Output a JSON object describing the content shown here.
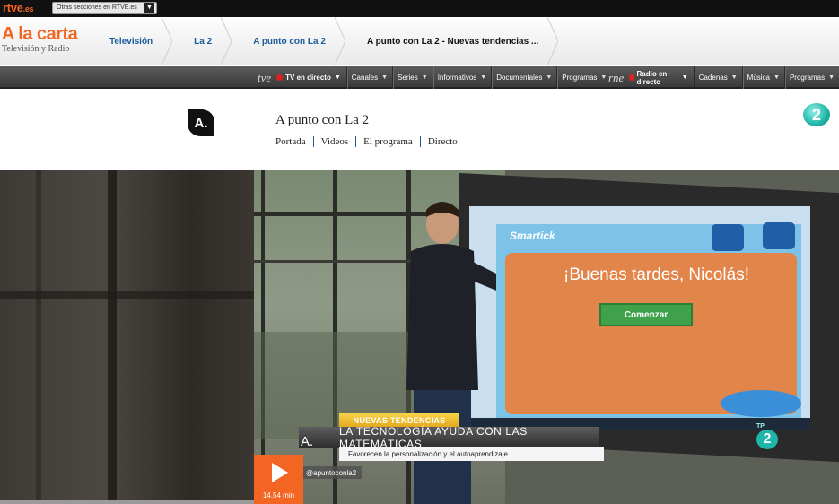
{
  "topbar": {
    "logo": "rtve",
    "logo_suffix": ".es",
    "sections_select": "Otras secciones en RTVE.es"
  },
  "header": {
    "brand_title": "A la carta",
    "brand_subtitle": "Televisión y Radio",
    "breadcrumbs": [
      "Televisión",
      "La 2",
      "A punto con La 2",
      "A punto con La 2 - Nuevas tendencias ..."
    ]
  },
  "navbar": {
    "tv_logo": "tve",
    "tv_live": "TV en directo",
    "tv_items": [
      "Canales",
      "Series",
      "Informativos",
      "Documentales",
      "Programas"
    ],
    "radio_logo": "rne",
    "radio_live": "Radio en directo",
    "radio_items": [
      "Cadenas",
      "Música",
      "Programas"
    ],
    "accent_live": "#e02020"
  },
  "program": {
    "logo_text": "A.",
    "title": "A punto con La 2",
    "nav": [
      "Portada",
      "Videos",
      "El programa",
      "Directo"
    ],
    "channel_badge": "2"
  },
  "video": {
    "app_name": "Smartick",
    "greeting": "¡Buenas tardes, Nicolás!",
    "start_button": "Comenzar",
    "tag": "NUEVAS TENDENCIAS",
    "headline": "LA TECNOLOGÍA AYUDA CON LAS MATEMÁTICAS",
    "subheadline": "Favorecen la personalización y el autoaprendizaje",
    "show_logo": "A.",
    "handle": "@apuntoconla2",
    "onair_tp": "TP",
    "onair_channel": "2",
    "duration": "14.54 min",
    "accent": "#f26522"
  }
}
